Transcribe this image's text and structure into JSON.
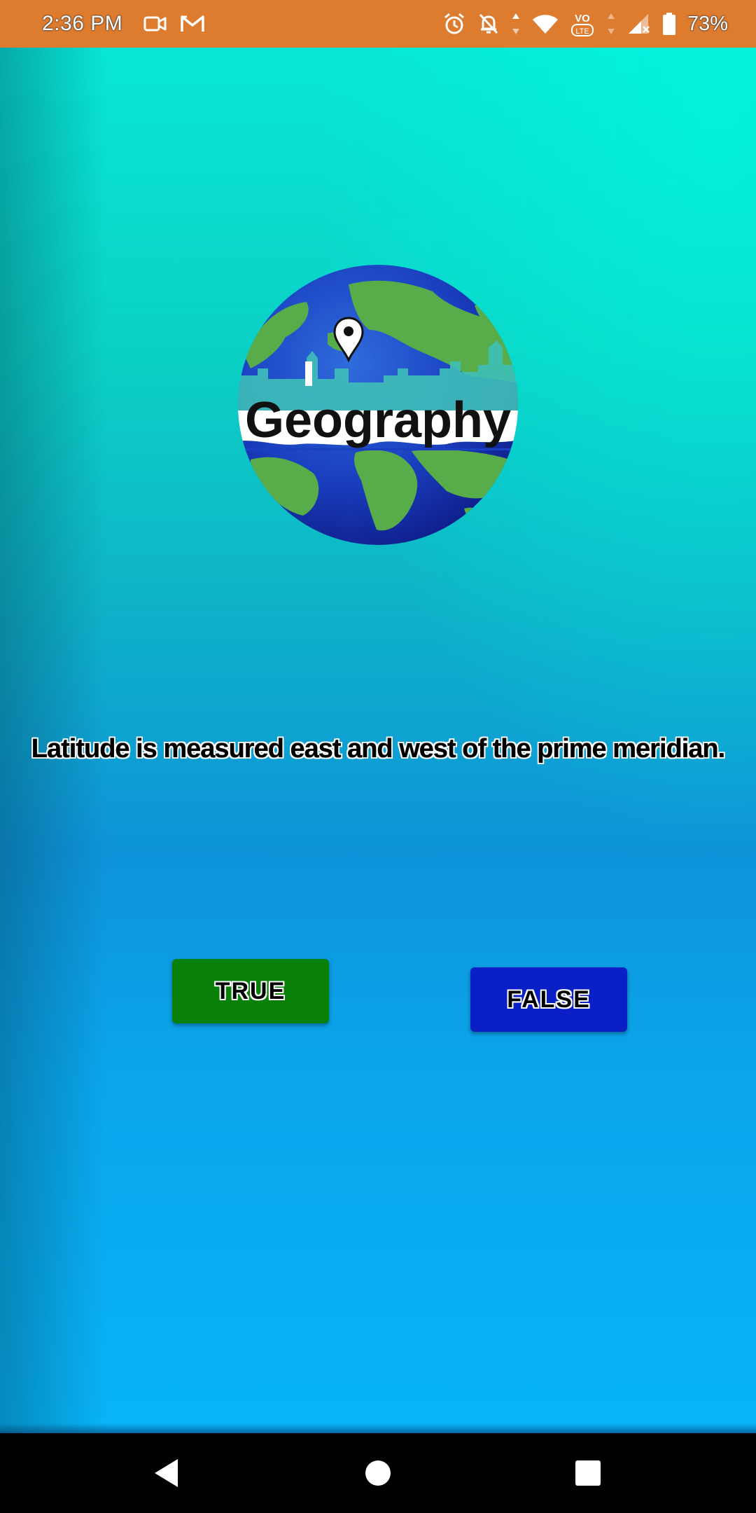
{
  "status_bar": {
    "time": "2:36 PM",
    "battery_percent": "73%",
    "bg_color": "#dd7b2f",
    "left_icons": [
      "video-camera-icon",
      "gmail-icon"
    ],
    "right_icons": [
      "alarm-icon",
      "notifications-off-icon",
      "data-arrows-icon",
      "wifi-icon",
      "volte-icon",
      "signal-icon",
      "battery-icon"
    ]
  },
  "logo": {
    "text": "Geography",
    "icon": "globe-with-pin-logo"
  },
  "question": {
    "text": "Latitude is measured east and west of the prime meridian."
  },
  "answers": {
    "true_label": "TRUE",
    "true_color": "#098008",
    "false_label": "FALSE",
    "false_color": "#0a1fc6"
  },
  "nav_bar": {
    "buttons": [
      "back-icon",
      "home-icon",
      "recents-icon"
    ]
  }
}
